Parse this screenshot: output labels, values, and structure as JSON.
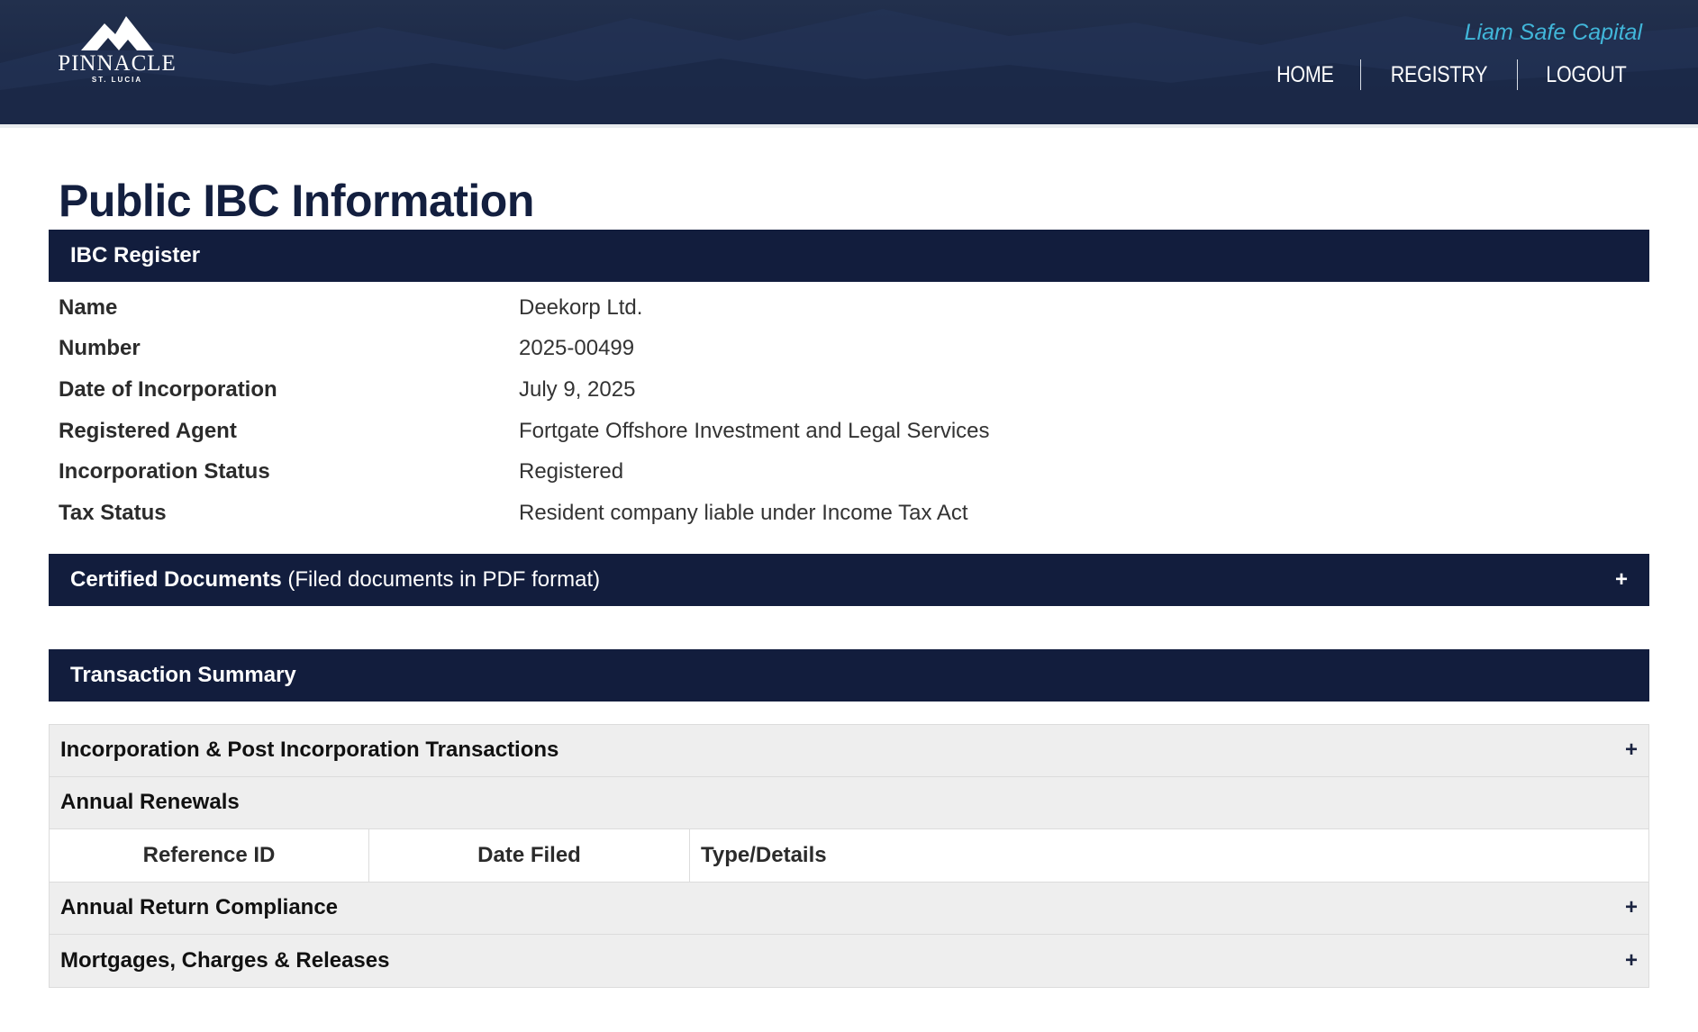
{
  "header": {
    "logo_brand": "PINNACLE",
    "logo_sub": "ST. LUCIA",
    "company": "Liam Safe Capital",
    "nav": [
      "HOME",
      "REGISTRY",
      "LOGOUT"
    ]
  },
  "page_title": "Public IBC Information",
  "register": {
    "title": "IBC Register",
    "rows": [
      {
        "label": "Name",
        "value": "Deekorp Ltd."
      },
      {
        "label": "Number",
        "value": "2025-00499"
      },
      {
        "label": "Date of Incorporation",
        "value": "July 9, 2025"
      },
      {
        "label": "Registered Agent",
        "value": "Fortgate Offshore Investment and Legal Services"
      },
      {
        "label": "Incorporation Status",
        "value": "Registered"
      },
      {
        "label": "Tax Status",
        "value": "Resident company liable under Income Tax Act"
      }
    ]
  },
  "documents": {
    "title": "Certified Documents",
    "subtitle": "(Filed documents in PDF format)",
    "toggle": "+"
  },
  "transactions": {
    "title": "Transaction Summary",
    "incorporation": {
      "label": "Incorporation & Post Incorporation Transactions",
      "toggle": "+"
    },
    "renewals": {
      "label": "Annual Renewals",
      "columns": [
        "Reference ID",
        "Date Filed",
        "Type/Details"
      ]
    },
    "compliance": {
      "label": "Annual Return Compliance",
      "toggle": "+"
    },
    "mortgages": {
      "label": "Mortgages, Charges & Releases",
      "toggle": "+"
    }
  },
  "colors": {
    "header_bg": "#1c2947",
    "bar_bg": "#121d3d",
    "title_color": "#131f3f",
    "company_color": "#41b6d9",
    "accordion_bg": "#eeeeee"
  }
}
